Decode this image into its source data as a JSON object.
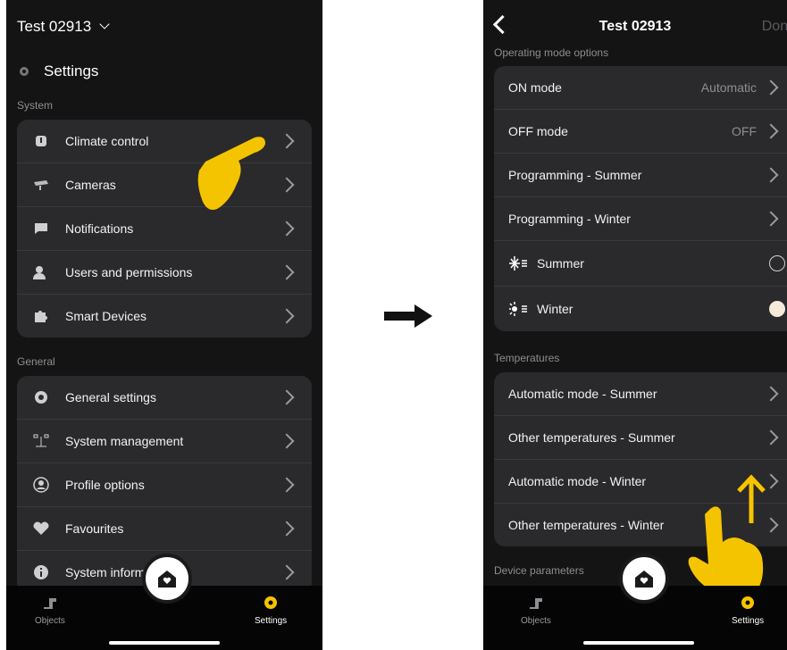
{
  "left": {
    "title": "Test 02913",
    "settings_title": "Settings",
    "system_label": "System",
    "system_items": [
      {
        "label": "Climate control",
        "icon": "thermometer-icon"
      },
      {
        "label": "Cameras",
        "icon": "camera-icon"
      },
      {
        "label": "Notifications",
        "icon": "chat-bubble-icon"
      },
      {
        "label": "Users and permissions",
        "icon": "users-icon"
      },
      {
        "label": "Smart Devices",
        "icon": "puzzle-icon"
      }
    ],
    "general_label": "General",
    "general_items": [
      {
        "label": "General settings",
        "icon": "gear-icon"
      },
      {
        "label": "System management",
        "icon": "network-icon"
      },
      {
        "label": "Profile options",
        "icon": "profile-icon"
      },
      {
        "label": "Favourites",
        "icon": "heart-icon"
      },
      {
        "label": "System informa",
        "icon": "info-icon"
      }
    ],
    "tabs": {
      "objects": "Objects",
      "settings": "Settings"
    }
  },
  "right": {
    "title": "Test 02913",
    "done": "Done",
    "operating_label": "Operating mode options",
    "operating_items": [
      {
        "label": "ON mode",
        "value": "Automatic"
      },
      {
        "label": "OFF mode",
        "value": "OFF"
      },
      {
        "label": "Programming - Summer",
        "value": ""
      },
      {
        "label": "Programming - Winter",
        "value": ""
      }
    ],
    "season_items": [
      {
        "label": "Summer",
        "icon": "snowflake-icon",
        "selected": false
      },
      {
        "label": "Winter",
        "icon": "sun-icon",
        "selected": true
      }
    ],
    "temperatures_label": "Temperatures",
    "temperature_items": [
      {
        "label": "Automatic mode - Summer"
      },
      {
        "label": "Other temperatures - Summer"
      },
      {
        "label": "Automatic mode - Winter"
      },
      {
        "label": "Other temperatures - Winter"
      }
    ],
    "device_label": "Device parameters",
    "tabs": {
      "objects": "Objects",
      "settings": "Settings"
    }
  },
  "colors": {
    "accent": "#f5c400",
    "background": "#141414",
    "card": "#2a2a2c"
  }
}
